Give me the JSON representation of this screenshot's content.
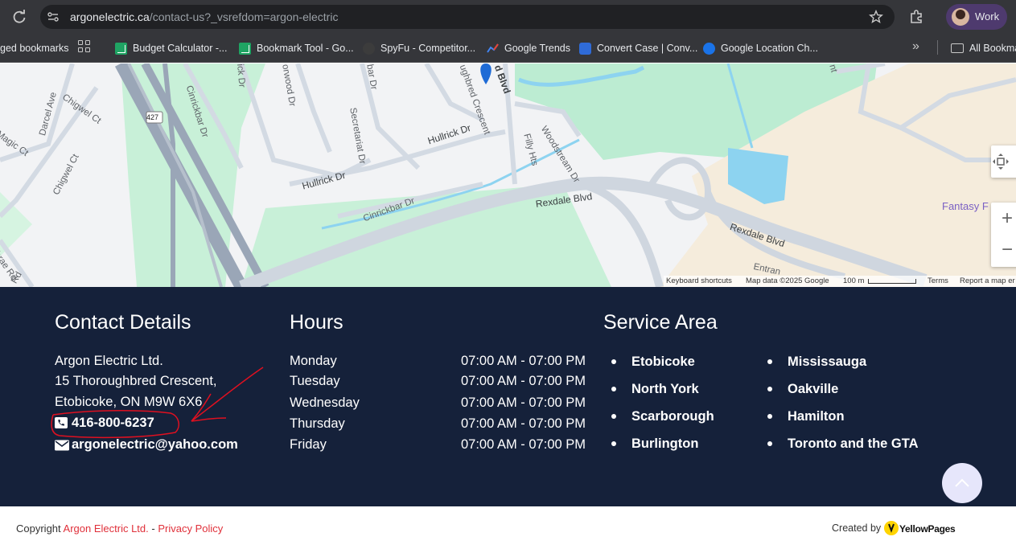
{
  "browser": {
    "url_host": "argonelectric.ca",
    "url_path": "/contact-us?_vsrefdom=argon-electric",
    "profile_label": "Work"
  },
  "bookmarks": {
    "managed": "ged bookmarks",
    "items": [
      {
        "label": "Budget Calculator -...",
        "icon": "sheets-icon"
      },
      {
        "label": "Bookmark Tool - Go...",
        "icon": "sheets-icon"
      },
      {
        "label": "SpyFu - Competitor...",
        "icon": "spyfu-icon"
      },
      {
        "label": "Google Trends",
        "icon": "trends-icon"
      },
      {
        "label": "Convert Case | Conv...",
        "icon": "convert-icon"
      },
      {
        "label": "Google Location Ch...",
        "icon": "location-icon"
      }
    ],
    "all_bookmarks": "All Bookma"
  },
  "map": {
    "labels": {
      "darcel": "Darcel Ave",
      "chigwel1": "Chigwel Ct",
      "magic": "Magic Ct",
      "chigwel2": "Chigwel Ct",
      "brae": "brae Rd",
      "rd": "Rd",
      "hwy": "427",
      "cinrickbar1": "Cinrickbar Dr",
      "ick": "ick Dr",
      "orwood": "orwood Dr",
      "secretariat": "Secretariat Dr",
      "bar": "bar Dr",
      "thoroughbred": "ughbred Crescent",
      "dblvd": "d Blvd",
      "hullrick1": "Hullrick Dr",
      "hullrick2": "Hullrick Dr",
      "cinrickbar2": "Cinrickbar Dr",
      "filly": "Filly Hts",
      "woodstream": "Woodstream Dr",
      "rexdale1": "Rexdale Blvd",
      "rexdale2": "Rexdale Blvd",
      "entra": "Entran",
      "fantasy": "Fantasy F",
      "nt": "nt"
    },
    "attribution": {
      "keyboard": "Keyboard shortcuts",
      "mapdata": "Map data ©2025 Google",
      "scale": "100 m",
      "terms": "Terms",
      "report": "Report a map er"
    },
    "controls": {
      "zoom_in": "+",
      "zoom_out": "−"
    }
  },
  "contact": {
    "title": "Contact Details",
    "company": "Argon Electric Ltd.",
    "street": "15 Thoroughbred Crescent,",
    "city": "Etobicoke, ON M9W 6X6",
    "phone": "416-800-6237",
    "email": "argonelectric@yahoo.com"
  },
  "hours": {
    "title": "Hours",
    "rows": [
      {
        "day": "Monday",
        "time": "07:00 AM - 07:00 PM"
      },
      {
        "day": "Tuesday",
        "time": "07:00 AM - 07:00 PM"
      },
      {
        "day": "Wednesday",
        "time": "07:00 AM - 07:00 PM"
      },
      {
        "day": "Thursday",
        "time": "07:00 AM - 07:00 PM"
      },
      {
        "day": "Friday",
        "time": "07:00 AM - 07:00 PM"
      }
    ]
  },
  "service": {
    "title": "Service Area",
    "col1": [
      "Etobicoke",
      "North York",
      "Scarborough",
      "Burlington"
    ],
    "col2": [
      "Mississauga",
      "Oakville",
      "Hamilton",
      "Toronto and the GTA"
    ]
  },
  "bottom": {
    "copyright": "Copyright",
    "company_link": "Argon Electric Ltd.",
    "dash": "-",
    "privacy": "Privacy Policy",
    "created_by": "Created by",
    "yp_brand": "YellowPages"
  },
  "colors": {
    "footer_bg": "#15213a",
    "link_red": "#e0303a",
    "annotation_red": "#e01020"
  }
}
